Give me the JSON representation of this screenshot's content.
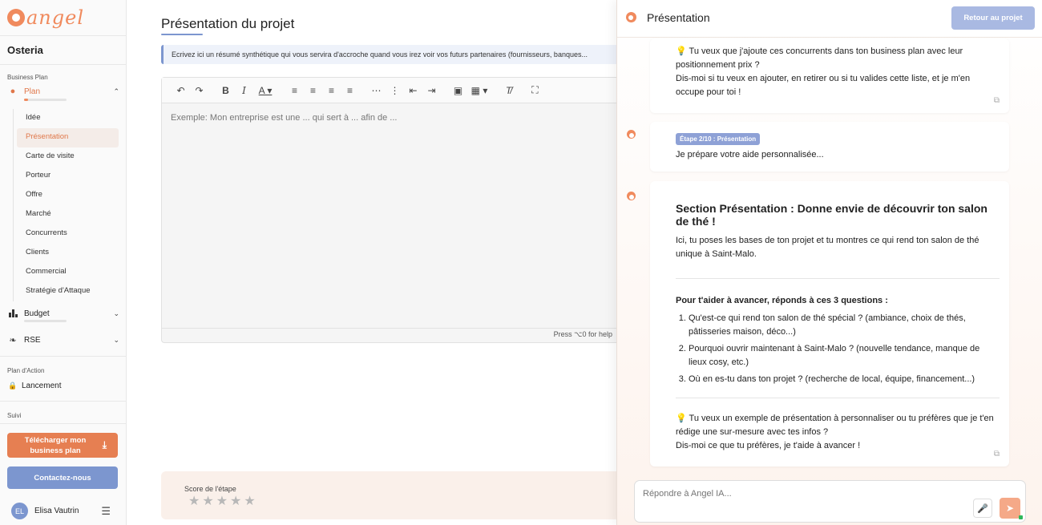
{
  "app": {
    "logo_text": "angel",
    "project_name": "Osteria"
  },
  "sidebar": {
    "section_business_plan": "Business Plan",
    "group_plan": {
      "label": "Plan",
      "progress": 0.1
    },
    "plan_items": [
      {
        "label": "Idée",
        "active": false
      },
      {
        "label": "Présentation",
        "active": true
      },
      {
        "label": "Carte de visite",
        "active": false
      },
      {
        "label": "Porteur",
        "active": false
      },
      {
        "label": "Offre",
        "active": false
      },
      {
        "label": "Marché",
        "active": false
      },
      {
        "label": "Concurrents",
        "active": false
      },
      {
        "label": "Clients",
        "active": false
      },
      {
        "label": "Commercial",
        "active": false
      },
      {
        "label": "Stratégie d'Attaque",
        "active": false
      }
    ],
    "group_budget": {
      "label": "Budget",
      "progress": 0.0
    },
    "group_rse": {
      "label": "RSE"
    },
    "section_action": "Plan d'Action",
    "lancement_label": "Lancement",
    "section_suivi": "Suivi",
    "download_label": "Télécharger mon business plan",
    "contact_label": "Contactez-nous",
    "user": {
      "initials": "EL",
      "name": "Elisa Vautrin"
    }
  },
  "main": {
    "title": "Présentation du projet",
    "hint": "Ecrivez ici un résumé synthétique qui vous servira d'accroche quand vous irez voir vos futurs partenaires (fournisseurs, banques...",
    "editor_placeholder": "Exemple: Mon entreprise est une ... qui sert à ... afin de ...",
    "help_text": "Press ⌥0 for help",
    "score_label": "Score de l'étape",
    "score_value": 0,
    "score_max": 5
  },
  "panel": {
    "title": "Présentation",
    "back_label": "Retour au projet",
    "msg1": {
      "line1": "💡 Tu veux que j'ajoute ces concurrents dans ton business plan avec leur positionnement prix ?",
      "line2": "Dis-moi si tu veux en ajouter, en retirer ou si tu valides cette liste, et je m'en occupe pour toi !"
    },
    "msg2": {
      "badge": "Étape 2/10 : Présentation",
      "text": "Je prépare votre aide personnalisée..."
    },
    "msg3": {
      "title": "Section Présentation : Donne envie de découvrir ton salon de thé !",
      "intro": "Ici, tu poses les bases de ton projet et tu montres ce qui rend ton salon de thé unique à Saint-Malo.",
      "subtitle": "Pour t'aider à avancer, réponds à ces 3 questions :",
      "questions": [
        "Qu'est-ce qui rend ton salon de thé spécial ? (ambiance, choix de thés, pâtisseries maison, déco...)",
        "Pourquoi ouvrir maintenant à Saint-Malo ? (nouvelle tendance, manque de lieux cosy, etc.)",
        "Où en es-tu dans ton projet ? (recherche de local, équipe, financement...)"
      ],
      "outro1": "💡 Tu veux un exemple de présentation à personnaliser ou tu préfères que je t'en rédige une sur-mesure avec tes infos ?",
      "outro2": "Dis-moi ce que tu préfères, je t'aide à avancer !"
    },
    "composer_placeholder": "Répondre à Angel IA..."
  },
  "colors": {
    "accent": "#f08a5d",
    "primary": "#7c96cf",
    "active_bg": "#f4ece8"
  },
  "icons": [
    "undo-icon",
    "redo-icon",
    "bold-icon",
    "italic-icon",
    "text-color-icon",
    "align-left-icon",
    "align-center-icon",
    "align-right-icon",
    "align-justify-icon",
    "bullet-list-icon",
    "numbered-list-icon",
    "outdent-icon",
    "indent-icon",
    "image-icon",
    "table-icon",
    "clear-format-icon",
    "fullscreen-icon",
    "download-icon",
    "menu-icon",
    "mic-icon",
    "send-icon",
    "copy-icon",
    "chart-icon",
    "leaf-icon",
    "lock-icon"
  ]
}
